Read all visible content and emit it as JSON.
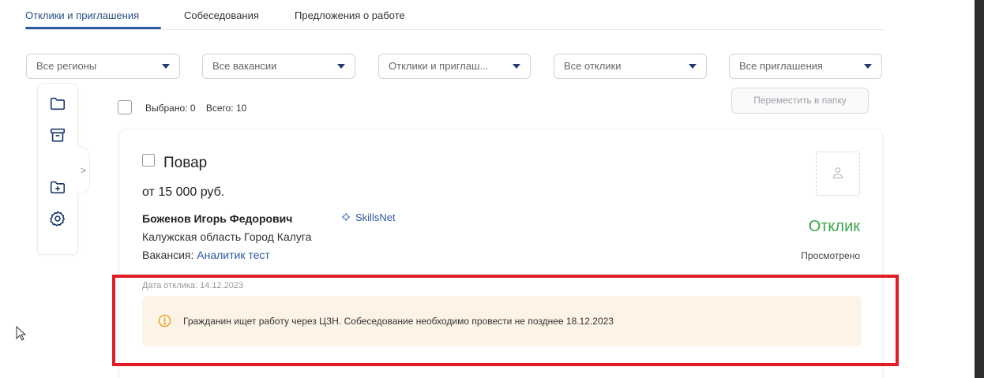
{
  "tabs": [
    {
      "label": "Отклики и приглашения",
      "active": true
    },
    {
      "label": "Собеседования",
      "active": false
    },
    {
      "label": "Предложения о работе",
      "active": false
    }
  ],
  "filters": [
    {
      "value": "Все регионы"
    },
    {
      "value": "Все вакансии"
    },
    {
      "value": "Отклики и приглаш..."
    },
    {
      "value": "Все отклики"
    },
    {
      "value": "Все приглашения"
    }
  ],
  "sidebar": {
    "icons": [
      "folder-icon",
      "archive-icon",
      "folder-plus-icon",
      "settings-icon"
    ],
    "toggle": ">"
  },
  "selection": {
    "selected": "Выбрано: 0",
    "total": "Всего: 10",
    "move_button": "Переместить в папку"
  },
  "card": {
    "title": "Повар",
    "salary": "от 15 000 руб.",
    "candidate": "Боженов Игорь Федорович",
    "badge": "SkillsNet",
    "region": "Калужская область Город Калуга",
    "vacancy_prefix": "Вакансия: ",
    "vacancy_link": "Аналитик тест",
    "status": "Отклик",
    "status_sub": "Просмотрено",
    "response_date": "Дата отклика: 14.12.2023",
    "notice": "Гражданин ищет работу через ЦЗН. Собеседование необходимо провести не позднее 18.12.2023"
  },
  "colors": {
    "accent": "#2a5aa0",
    "status_green": "#3aa54a",
    "notice_bg": "#fdf3e6",
    "notice_icon": "#e6a020",
    "highlight": "#e01c24"
  }
}
